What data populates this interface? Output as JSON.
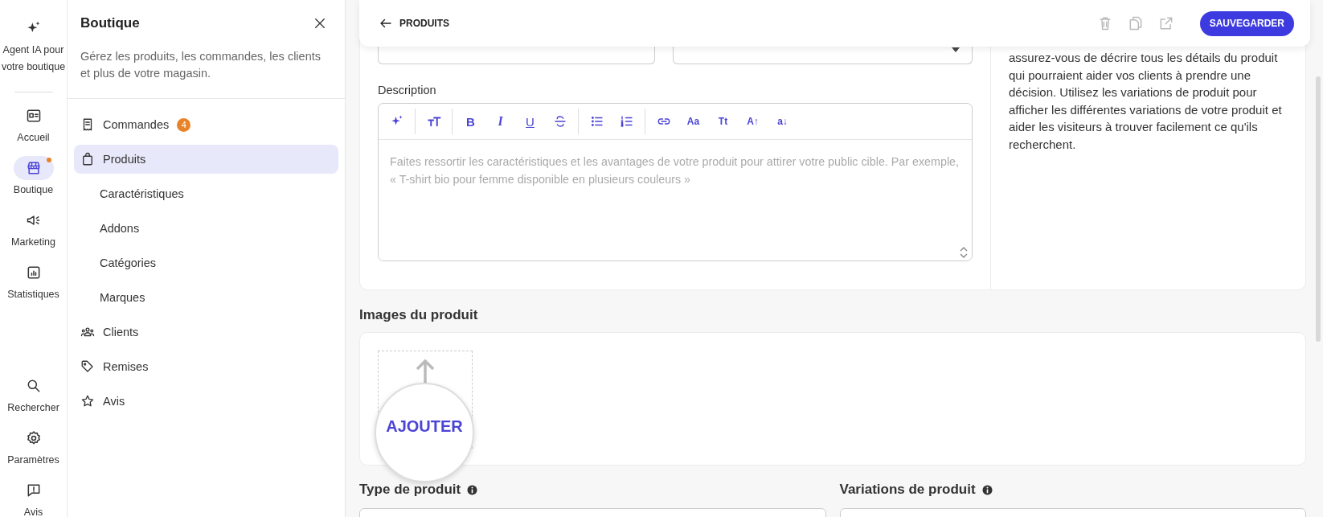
{
  "rail": {
    "top": [
      {
        "label": "Agent IA pour votre boutique",
        "selected": false,
        "dot": false
      },
      {
        "label": "Accueil",
        "selected": false,
        "dot": false
      },
      {
        "label": "Boutique",
        "selected": true,
        "dot": true
      },
      {
        "label": "Marketing",
        "selected": false,
        "dot": false
      },
      {
        "label": "Statistiques",
        "selected": false,
        "dot": false
      }
    ],
    "bottom": [
      {
        "label": "Rechercher",
        "selected": false,
        "dot": false
      },
      {
        "label": "Paramètres",
        "selected": false,
        "dot": false
      },
      {
        "label": "Avis",
        "selected": false,
        "dot": false
      }
    ]
  },
  "panel": {
    "title": "Boutique",
    "description": "Gérez les produits, les commandes, les clients et plus de votre magasin.",
    "items": [
      {
        "label": "Commandes",
        "badge": "4",
        "selected": false
      },
      {
        "label": "Produits",
        "selected": true,
        "children": [
          {
            "label": "Caractéristiques",
            "selected": false
          },
          {
            "label": "Addons",
            "selected": false
          },
          {
            "label": "Catégories",
            "selected": false
          },
          {
            "label": "Marques",
            "selected": false
          }
        ]
      },
      {
        "label": "Clients",
        "selected": false
      },
      {
        "label": "Remises",
        "selected": false
      },
      {
        "label": "Avis",
        "selected": false
      }
    ]
  },
  "header": {
    "back_label": "PRODUITS",
    "save_button": "SAUVEGARDER"
  },
  "form": {
    "description_label": "Description",
    "toolbar": [
      [
        {
          "kind": "ai"
        }
      ],
      [
        {
          "kind": "heading"
        }
      ],
      [
        {
          "kind": "bold",
          "label": "B"
        },
        {
          "kind": "italic",
          "label": "I"
        },
        {
          "kind": "underline",
          "label": "U"
        },
        {
          "kind": "strike"
        }
      ],
      [
        {
          "kind": "bullets"
        },
        {
          "kind": "numbers"
        }
      ],
      [
        {
          "kind": "link"
        },
        {
          "kind": "plain",
          "label": "Aa"
        },
        {
          "kind": "plain",
          "label": "Tt"
        },
        {
          "kind": "plain",
          "label": "A↑"
        },
        {
          "kind": "plain",
          "label": "a↓"
        }
      ]
    ],
    "description_placeholder": "Faites ressortir les caractéristiques et les avantages de votre produit pour attirer votre public cible. Par exemple, « T-shirt bio pour femme disponible en plusieurs couleurs »",
    "help_text": "assurez-vous de décrire tous les détails du produit qui pourraient aider vos clients à prendre une décision. Utilisez les variations de produit pour afficher les différentes variations de votre produit et aider les visiteurs à trouver facilement ce qu'ils recherchent.",
    "images_title": "Images du produit",
    "add_image_label": "AJOUTER",
    "product_type_label": "Type de produit",
    "variations_label": "Variations de produit"
  }
}
